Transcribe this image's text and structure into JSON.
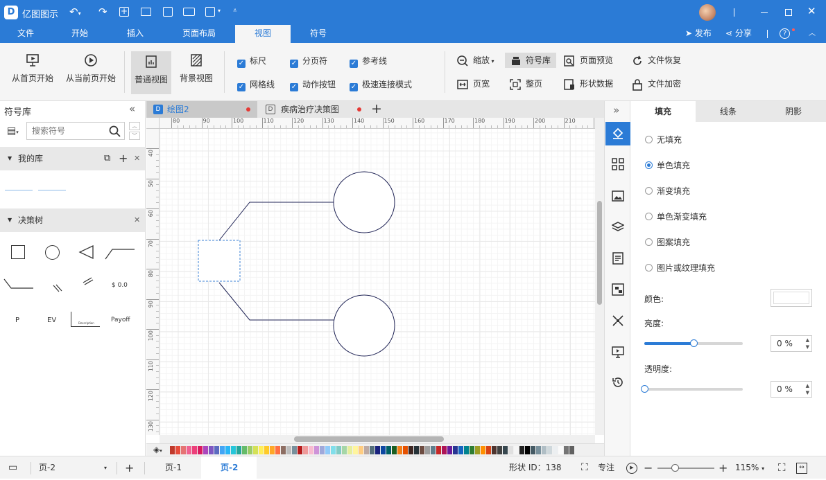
{
  "app": {
    "title": "亿图图示",
    "avatar_icon": "user-avatar"
  },
  "menu": [
    "文件",
    "开始",
    "插入",
    "页面布局",
    "视图",
    "符号"
  ],
  "menu_active": "视图",
  "header_right": {
    "publish": "发布",
    "share": "分享",
    "help": "?"
  },
  "ribbon": {
    "from_first": "从首页开始",
    "from_current": "从当前页开始",
    "normal_view": "普通视图",
    "background_view": "背景视图",
    "checks": {
      "ruler": "标尺",
      "page_break": "分页符",
      "guides": "参考线",
      "grid": "网格线",
      "action_button": "动作按钮",
      "fast_connect": "极速连接模式"
    },
    "zoom": "缩放",
    "symbol_lib": "符号库",
    "page_preview": "页面预览",
    "file_recover": "文件恢复",
    "page_width": "页宽",
    "whole_page": "整页",
    "shape_data": "形状数据",
    "file_encrypt": "文件加密"
  },
  "left": {
    "title": "符号库",
    "search_placeholder": "搜索符号",
    "my_lib": "我的库",
    "decision_tree": "决策树",
    "symbols": {
      "p": "P",
      "ev": "EV",
      "payoff": "Payoff",
      "value": "$ 0.0",
      "desc": "Description"
    }
  },
  "tabs": [
    {
      "label": "绘图2",
      "active": true
    },
    {
      "label": "疾病治疗决策图",
      "active": false
    }
  ],
  "ruler_h": [
    "80",
    "90",
    "100",
    "110",
    "120",
    "130",
    "140",
    "150",
    "160",
    "170",
    "180",
    "190",
    "200",
    "210",
    "2"
  ],
  "ruler_v": [
    "40",
    "50",
    "60",
    "70",
    "80",
    "90",
    "100",
    "110",
    "120",
    "130"
  ],
  "right": {
    "tabs": [
      "填充",
      "线条",
      "阴影"
    ],
    "fill_options": [
      "无填充",
      "单色填充",
      "渐变填充",
      "单色渐变填充",
      "图案填充",
      "图片或纹理填充"
    ],
    "selected_fill": "单色填充",
    "color_label": "颜色:",
    "color_value": "#ffffff",
    "brightness_label": "亮度:",
    "brightness_value": "0 %",
    "brightness_fraction": 0.5,
    "opacity_label": "透明度:",
    "opacity_value": "0 %",
    "opacity_fraction": 0
  },
  "status": {
    "page_selector": "页-2",
    "page1": "页-1",
    "page2": "页-2",
    "shape_id": "形状 ID：138",
    "focus": "专注",
    "zoom": "115%"
  },
  "colors": {
    "accent": "#2b7bd6",
    "titlebar": "#2b7bd6"
  },
  "palette": [
    "#c0392b",
    "#e74c3c",
    "#e57373",
    "#f06292",
    "#ec407a",
    "#d81b60",
    "#ab47bc",
    "#7e57c2",
    "#5c6bc0",
    "#42a5f5",
    "#29b6f6",
    "#26c6da",
    "#26a69a",
    "#66bb6a",
    "#9ccc65",
    "#d4e157",
    "#ffee58",
    "#ffca28",
    "#ffa726",
    "#ff7043",
    "#8d6e63",
    "#bdbdbd",
    "#78909c",
    "#b71c1c",
    "#ef9a9a",
    "#f8bbd0",
    "#ce93d8",
    "#9fa8da",
    "#90caf9",
    "#80deea",
    "#80cbc4",
    "#a5d6a7",
    "#e6ee9c",
    "#fff59d",
    "#ffcc80",
    "#bcaaa4",
    "#546e7a",
    "#1a237e",
    "#0d47a1",
    "#006064",
    "#1b5e20",
    "#f57f17",
    "#e65100",
    "#3e2723",
    "#263238",
    "#6d4c41",
    "#9e9e9e",
    "#607d8b",
    "#c62828",
    "#ad1457",
    "#6a1b9a",
    "#283593",
    "#1565c0",
    "#00838f",
    "#2e7d32",
    "#9e9d24",
    "#ff8f00",
    "#d84315",
    "#4e342e",
    "#424242",
    "#37474f",
    "#e0e0e0",
    "#f5f5f5",
    "#212121",
    "#000000",
    "#455a64",
    "#78909c",
    "#b0bec5",
    "#cfd8dc",
    "#eceff1",
    "#fafafa",
    "#757575",
    "#616161"
  ]
}
